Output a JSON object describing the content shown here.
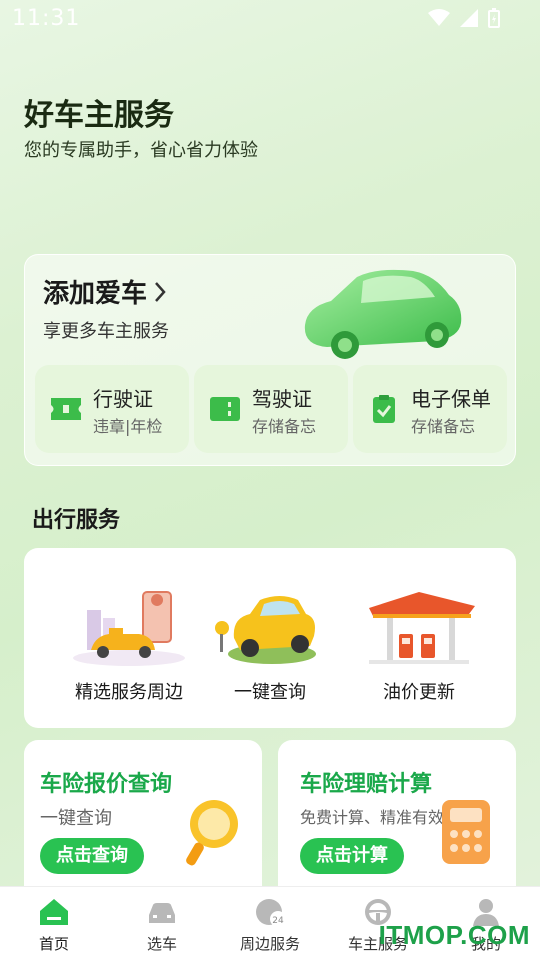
{
  "status_bar": {
    "time": "11:31"
  },
  "hero": {
    "title": "好车主服务",
    "subtitle": "您的专属助手，省心省力体验"
  },
  "car_card": {
    "title": "添加爱车",
    "subtitle": "享更多车主服务",
    "documents": [
      {
        "title": "行驶证",
        "subtitle": "违章|年检",
        "icon": "ticket-icon"
      },
      {
        "title": "驾驶证",
        "subtitle": "存储备忘",
        "icon": "license-card-icon"
      },
      {
        "title": "电子保单",
        "subtitle": "存储备忘",
        "icon": "clipboard-check-icon"
      }
    ]
  },
  "travel_services": {
    "title": "出行服务",
    "items": [
      {
        "label": "精选服务周边"
      },
      {
        "label": "一键查询"
      },
      {
        "label": "油价更新"
      }
    ]
  },
  "promos": [
    {
      "title": "车险报价查询",
      "subtitle": "一键查询",
      "button": "点击查询"
    },
    {
      "title": "车险理赔计算",
      "subtitle": "免费计算、精准有效",
      "button": "点击计算"
    }
  ],
  "tab_bar": {
    "tabs": [
      {
        "label": "首页",
        "icon": "home-icon",
        "active": true
      },
      {
        "label": "选车",
        "icon": "car-icon"
      },
      {
        "label": "周边服务",
        "icon": "nearby-24h-icon"
      },
      {
        "label": "车主服务",
        "icon": "steering-wheel-icon"
      },
      {
        "label": "我的",
        "icon": "user-icon"
      }
    ]
  },
  "watermark": "ITMOP.COM",
  "colors": {
    "accent": "#29c252",
    "accent_text": "#1aa84a",
    "doc_bg": "#e6f6dc"
  }
}
